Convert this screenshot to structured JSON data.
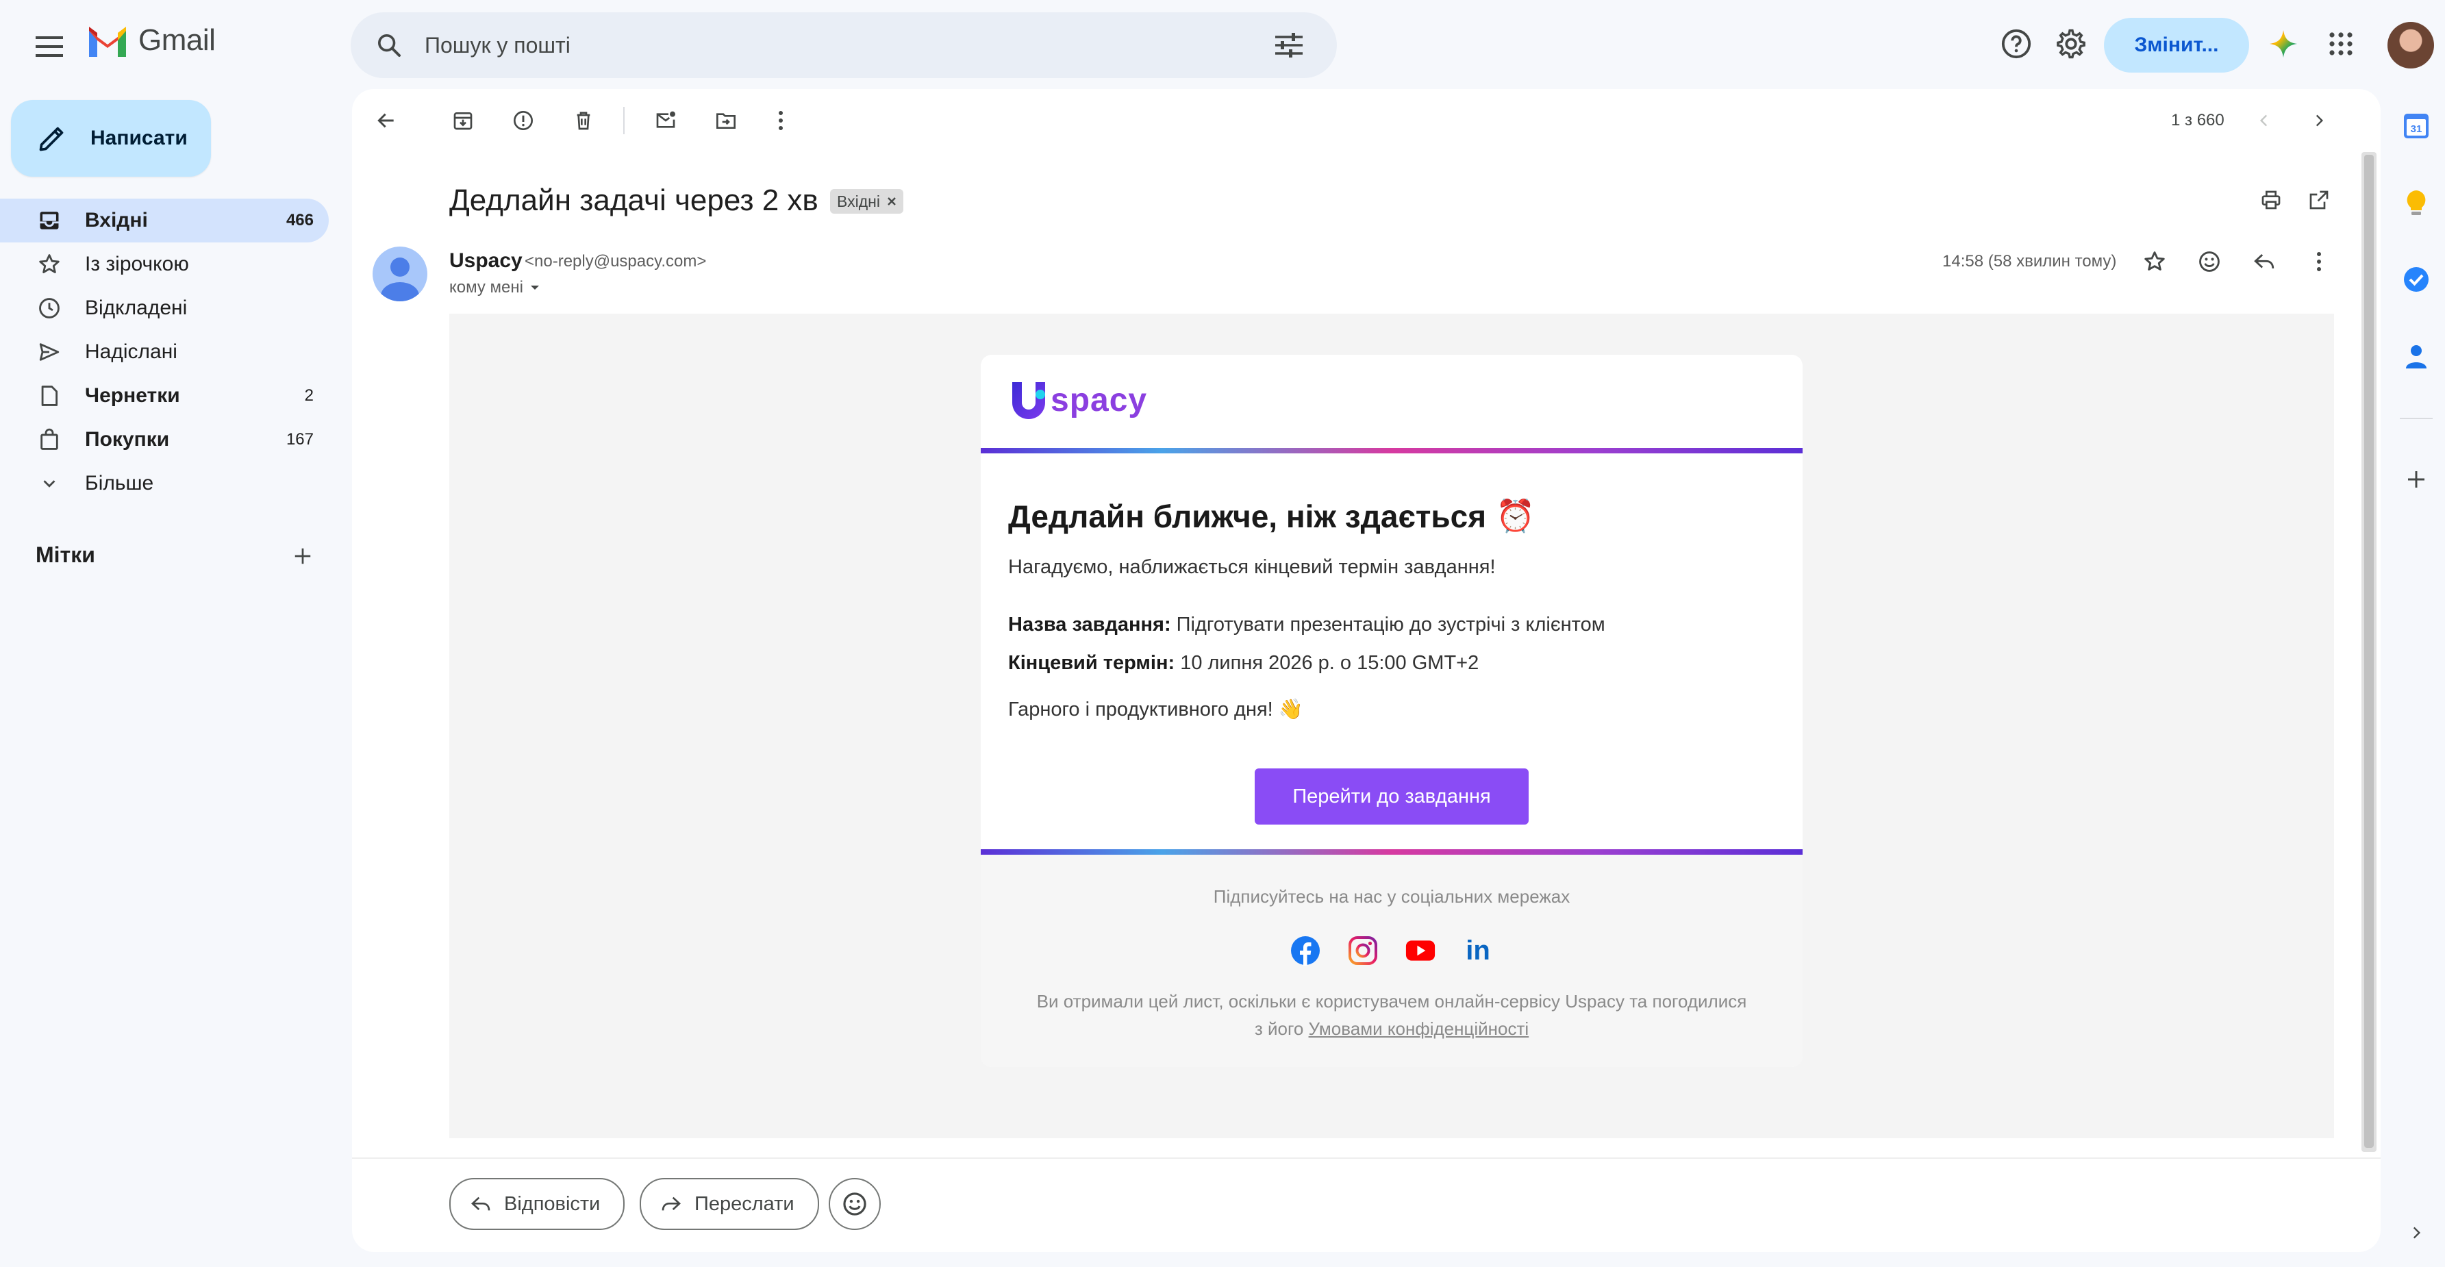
{
  "app": {
    "name": "Gmail",
    "search_placeholder": "Пошук у пошті",
    "account_button": "Змінит..."
  },
  "sidebar": {
    "compose_label": "Написати",
    "items": [
      {
        "label": "Вхідні",
        "count": "466",
        "icon": "inbox-icon",
        "active": true,
        "bold": true
      },
      {
        "label": "Із зірочкою",
        "count": "",
        "icon": "star-icon",
        "active": false,
        "bold": false
      },
      {
        "label": "Відкладені",
        "count": "",
        "icon": "clock-icon",
        "active": false,
        "bold": false
      },
      {
        "label": "Надіслані",
        "count": "",
        "icon": "send-icon",
        "active": false,
        "bold": false
      },
      {
        "label": "Чернетки",
        "count": "2",
        "icon": "draft-icon",
        "active": false,
        "bold": true
      },
      {
        "label": "Покупки",
        "count": "167",
        "icon": "shopping-icon",
        "active": false,
        "bold": true
      },
      {
        "label": "Більше",
        "count": "",
        "icon": "chevron-down-icon",
        "active": false,
        "bold": false
      }
    ],
    "labels_title": "Мітки"
  },
  "toolbar": {
    "paging": "1 з 660"
  },
  "message": {
    "subject": "Дедлайн задачі через 2 хв",
    "tag": "Вхідні",
    "sender_name": "Uspacy",
    "sender_email": "<no-reply@uspacy.com>",
    "to": "кому мені",
    "time": "14:58 (58 хвилин тому)"
  },
  "email": {
    "brand_u": "U",
    "brand": "spacy",
    "headline": "Дедлайн ближче, ніж здається",
    "headline_emoji": "⏰",
    "intro": "Нагадуємо, наближається кінцевий термін завдання!",
    "task_label": "Назва завдання:",
    "task_value": "Підготувати презентацію до зустрічі з клієнтом",
    "deadline_label": "Кінцевий термін:",
    "deadline_value": "10 липня 2026 р. о 15:00 GMT+2",
    "wish": "Гарного і продуктивного дня!",
    "wish_emoji": "👋",
    "cta": "Перейти до завдання",
    "follow": "Підписуйтесь на нас у соціальних мережах",
    "legal_line1": "Ви отримали цей лист, оскільки є користувачем онлайн-сервісу Uspacy та погодилися",
    "legal_line2_prefix": "з його",
    "legal_link": "Умовами конфіденційності",
    "linkedin_text": "in"
  },
  "actions": {
    "reply": "Відповісти",
    "forward": "Переслати"
  },
  "rail": {
    "calendar_day": "31"
  },
  "colors": {
    "accent": "#0b57d0",
    "compose_bg": "#c2e7ff",
    "active_nav": "#d3e3fd",
    "cta": "#8a4cf5"
  }
}
